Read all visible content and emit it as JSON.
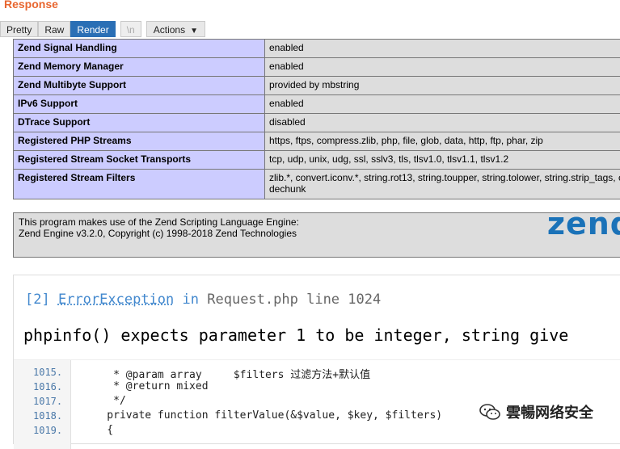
{
  "panel": {
    "title": "Response"
  },
  "toolbar": {
    "pretty": "Pretty",
    "raw": "Raw",
    "render": "Render",
    "newline": "\\n",
    "actions": "Actions"
  },
  "phpinfo_rows": [
    {
      "key": "Zend Signal Handling",
      "value": "enabled"
    },
    {
      "key": "Zend Memory Manager",
      "value": "enabled"
    },
    {
      "key": "Zend Multibyte Support",
      "value": "provided by mbstring"
    },
    {
      "key": "IPv6 Support",
      "value": "enabled"
    },
    {
      "key": "DTrace Support",
      "value": "disabled"
    },
    {
      "key": "Registered PHP Streams",
      "value": "https, ftps, compress.zlib, php, file, glob, data, http, ftp, phar, zip"
    },
    {
      "key": "Registered Stream Socket Transports",
      "value": "tcp, udp, unix, udg, ssl, sslv3, tls, tlsv1.0, tlsv1.1, tlsv1.2"
    },
    {
      "key": "Registered Stream Filters",
      "value": "zlib.*, convert.iconv.*, string.rot13, string.toupper, string.tolower, string.strip_tags, c",
      "value2": "dechunk"
    }
  ],
  "zend": {
    "line1": "This program makes use of the Zend Scripting Language Engine:",
    "line2": "Zend Engine v3.2.0, Copyright (c) 1998-2018 Zend Technologies",
    "logo": "zend"
  },
  "exception": {
    "index": "[2]",
    "class": "ErrorException",
    "in": "in",
    "file": "Request.php",
    "line_label": "line 1024",
    "message": "phpinfo() expects parameter 1 to be integer, string give"
  },
  "code_lines": [
    {
      "no": "1015.",
      "text": "     * @param array     $filters 过滤方法+默认值"
    },
    {
      "no": "1016.",
      "text": "     * @return mixed"
    },
    {
      "no": "1017.",
      "text": "     */"
    },
    {
      "no": "1018.",
      "text": "    private function filterValue(&$value, $key, $filters)"
    },
    {
      "no": "1019.",
      "text": "    {"
    }
  ],
  "watermark": {
    "text": "雲暢网络安全",
    "icon": "wechat-icon"
  }
}
